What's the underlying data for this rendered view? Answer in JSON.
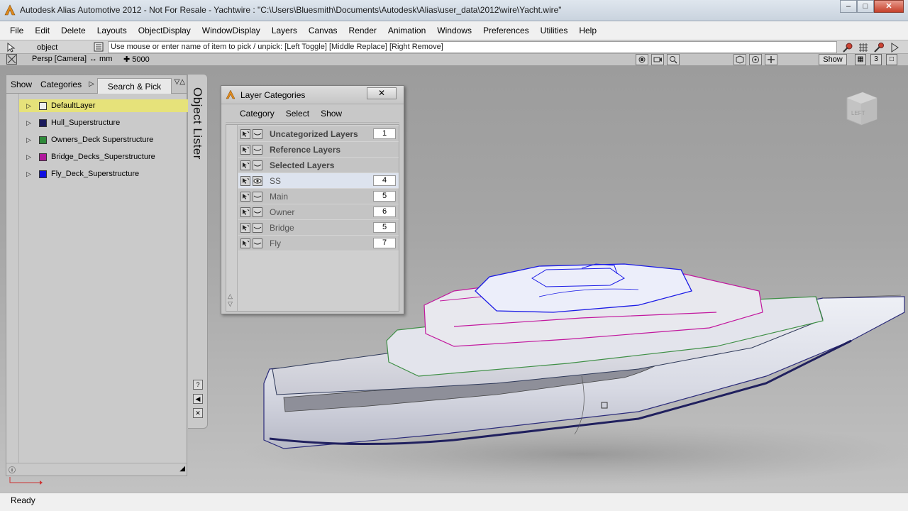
{
  "window": {
    "title": "Autodesk Alias Automotive 2012 - Not For Resale - Yachtwire : \"C:\\Users\\Bluesmith\\Documents\\Autodesk\\Alias\\user_data\\2012\\wire\\Yacht.wire\"",
    "minimize": "–",
    "maximize": "□",
    "close": "✕"
  },
  "menubar": {
    "items": [
      "File",
      "Edit",
      "Delete",
      "Layouts",
      "ObjectDisplay",
      "WindowDisplay",
      "Layers",
      "Canvas",
      "Render",
      "Animation",
      "Windows",
      "Preferences",
      "Utilities",
      "Help"
    ]
  },
  "prompt": {
    "mode": "object",
    "text": "Use mouse or enter name of item to pick / unpick: [Left Toggle] [Middle Replace] [Right Remove]"
  },
  "camera": {
    "view": "Persp [Camera]",
    "units": "↔ mm",
    "grid": "5000",
    "show_button": "Show",
    "window_count": "3"
  },
  "lister": {
    "tabs": [
      "Show",
      "Categories",
      "Search & Pick"
    ],
    "vertical_title": "Object Lister",
    "layers": [
      {
        "name": "DefaultLayer",
        "color": "#eeeeee",
        "selected": true
      },
      {
        "name": "Hull_Superstructure",
        "color": "#1a1a5c",
        "selected": false
      },
      {
        "name": "Owners_Deck Superstructure",
        "color": "#2f8a3a",
        "selected": false
      },
      {
        "name": "Bridge_Decks_Superstructure",
        "color": "#b0189c",
        "selected": false
      },
      {
        "name": "Fly_Deck_Superstructure",
        "color": "#1010e0",
        "selected": false
      }
    ]
  },
  "layer_categories": {
    "title": "Layer Categories",
    "close": "✕",
    "menu": [
      "Category",
      "Select",
      "Show"
    ],
    "rows": [
      {
        "name": "Uncategorized Layers",
        "count": "1",
        "bold": true,
        "visible": false
      },
      {
        "name": "Reference Layers",
        "count": "",
        "bold": true,
        "visible": false
      },
      {
        "name": "Selected Layers",
        "count": "",
        "bold": true,
        "visible": false
      },
      {
        "name": "SS",
        "count": "4",
        "bold": false,
        "visible": true
      },
      {
        "name": "Main",
        "count": "5",
        "bold": false,
        "visible": false
      },
      {
        "name": "Owner",
        "count": "6",
        "bold": false,
        "visible": false
      },
      {
        "name": "Bridge",
        "count": "5",
        "bold": false,
        "visible": false
      },
      {
        "name": "Fly",
        "count": "7",
        "bold": false,
        "visible": false
      }
    ]
  },
  "viewcube": {
    "face": "LEFT"
  },
  "status": {
    "text": "Ready"
  },
  "colors": {
    "hull_outline": "#2b2b7a",
    "owners_deck": "#3e8f45",
    "bridge_deck": "#c2189e",
    "fly_deck": "#1a1ae6",
    "selection": "#e6e27a"
  }
}
